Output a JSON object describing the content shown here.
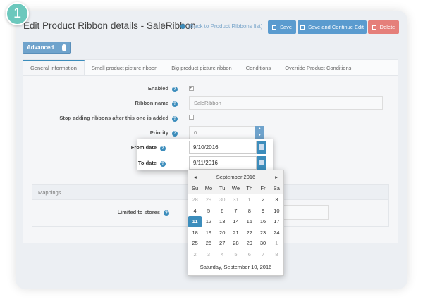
{
  "step_badge": "1",
  "header": {
    "title": "Edit Product Ribbon details - SaleRibbon",
    "back_link": "(Back to Product Ribbons list)",
    "save": "Save",
    "save_continue": "Save and Continue Edit",
    "delete": "Delete"
  },
  "colors": {
    "primary": "#3c8dbc",
    "button": "#5a9bcf",
    "delete": "#e57f7a",
    "badge": "#6cc8bd"
  },
  "advanced_toggle": {
    "label": "Advanced",
    "on": true
  },
  "tabs": [
    {
      "label": "General information",
      "active": true
    },
    {
      "label": "Small product picture ribbon"
    },
    {
      "label": "Big product picture ribbon"
    },
    {
      "label": "Conditions"
    },
    {
      "label": "Override Product Conditions"
    }
  ],
  "form": {
    "enabled": {
      "label": "Enabled",
      "checked": true
    },
    "ribbon_name": {
      "label": "Ribbon name",
      "value": "SaleRibbon"
    },
    "stop_adding": {
      "label": "Stop adding ribbons after this one is added",
      "checked": false
    },
    "priority": {
      "label": "Priority",
      "value": "0"
    },
    "from_date": {
      "label": "From date",
      "value": "9/10/2016"
    },
    "to_date": {
      "label": "To date",
      "value": "9/11/2016"
    }
  },
  "mappings": {
    "title": "Mappings",
    "limited_to_stores": "Limited to stores"
  },
  "calendar": {
    "month": "September 2016",
    "prev": "◂",
    "next": "▸",
    "days": [
      "Su",
      "Mo",
      "Tu",
      "We",
      "Th",
      "Fr",
      "Sa"
    ],
    "weeks": [
      [
        "28",
        "29",
        "30",
        "31",
        "1",
        "2",
        "3"
      ],
      [
        "4",
        "5",
        "6",
        "7",
        "8",
        "9",
        "10"
      ],
      [
        "11",
        "12",
        "13",
        "14",
        "15",
        "16",
        "17"
      ],
      [
        "18",
        "19",
        "20",
        "21",
        "22",
        "23",
        "24"
      ],
      [
        "25",
        "26",
        "27",
        "28",
        "29",
        "30",
        "1"
      ],
      [
        "2",
        "3",
        "4",
        "5",
        "6",
        "7",
        "8"
      ]
    ],
    "selected": "11",
    "footer": "Saturday, September 10, 2016"
  }
}
